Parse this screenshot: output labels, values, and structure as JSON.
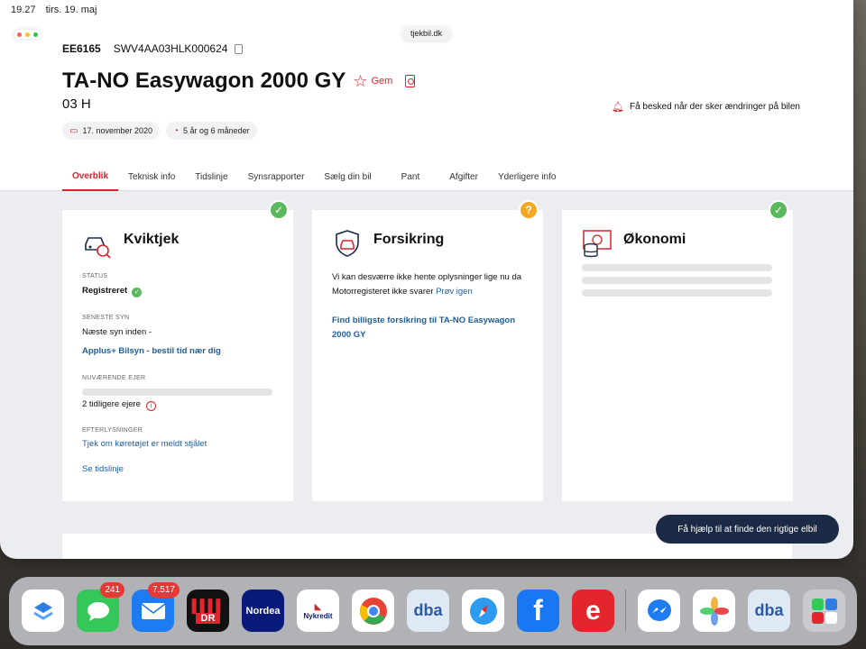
{
  "status_bar": {
    "time": "19.27",
    "date": "tirs. 19. maj"
  },
  "browser": {
    "url": "tjekbil.dk"
  },
  "vehicle": {
    "plate": "EE6165",
    "vin": "SWV4AA03HLK000624",
    "title": "TA-NO Easywagon 2000 GY",
    "save_label": "Gem",
    "variant": "03 H",
    "first_registration": "17. november 2020",
    "age": "5 år og 6 måneder",
    "notify_label": "Få besked når der sker ændringer på bilen"
  },
  "tabs": [
    {
      "label": "Overblik",
      "active": true
    },
    {
      "label": "Teknisk info"
    },
    {
      "label": "Tidslinje"
    },
    {
      "label": "Synsrapporter"
    },
    {
      "label": "Sælg din bil"
    },
    {
      "label": "Pant"
    },
    {
      "label": "Afgifter"
    },
    {
      "label": "Yderligere info"
    }
  ],
  "cards": {
    "kviktjek": {
      "title": "Kviktjek",
      "badge": "✓",
      "status_label": "STATUS",
      "status_value": "Registreret",
      "last_inspection_label": "SENESTE SYN",
      "next_inspection": "Næste syn inden -",
      "booking_link": "Applus+ Bilsyn - bestil tid nær dig",
      "owner_label": "NUVÆRENDE EJER",
      "previous_owners": "2 tidligere ejere",
      "wanted_label": "EFTERLYSNINGER",
      "stolen_link": "Tjek om køretøjet er meldt stjålet",
      "timeline_link": "Se tidslinje"
    },
    "forsikring": {
      "title": "Forsikring",
      "badge": "?",
      "message": "Vi kan desværre ikke hente oplysninger lige nu da Motorregisteret ikke svarer",
      "retry_link": "Prøv igen",
      "cta": "Find billigste forsikring til TA-NO Easywagon 2000 GY"
    },
    "okonomi": {
      "title": "Økonomi",
      "badge": "✓"
    }
  },
  "help_button": "Få hjælp til at finde den rigtige elbil",
  "dock": [
    {
      "name": "tasks",
      "label": "",
      "color": "#ffffff"
    },
    {
      "name": "messages",
      "label": "",
      "color": "#34c759",
      "badge": "241"
    },
    {
      "name": "mail",
      "label": "",
      "color": "#1e7cf2",
      "badge": "7.517"
    },
    {
      "name": "dr",
      "label": "DR",
      "color": "#111111"
    },
    {
      "name": "nordea",
      "label": "Nordea",
      "color": "#0a1a7a"
    },
    {
      "name": "nykredit",
      "label": "Nykredit",
      "color": "#ffffff"
    },
    {
      "name": "chrome",
      "label": "",
      "color": "#ffffff"
    },
    {
      "name": "dba",
      "label": "dba",
      "color": "#dfe9f6"
    },
    {
      "name": "safari",
      "label": "",
      "color": "#ffffff"
    },
    {
      "name": "facebook",
      "label": "f",
      "color": "#1877f2"
    },
    {
      "name": "e-app",
      "label": "e",
      "color": "#e3262e"
    },
    {
      "name": "messenger",
      "label": "",
      "color": "#ffffff"
    },
    {
      "name": "photos",
      "label": "",
      "color": "#ffffff"
    },
    {
      "name": "dba-2",
      "label": "dba",
      "color": "#dfe9f6"
    },
    {
      "name": "app-folder",
      "label": "",
      "color": "#c8cad0"
    }
  ]
}
